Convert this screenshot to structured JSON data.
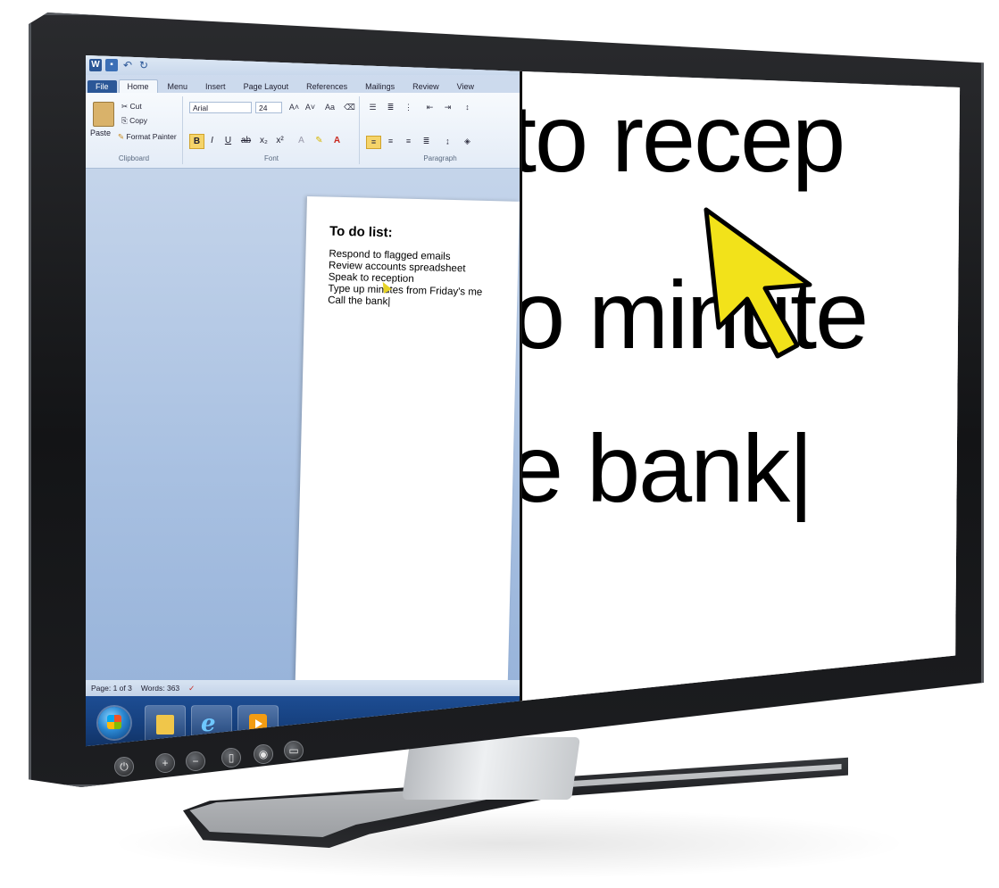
{
  "word": {
    "tabs": [
      "File",
      "Home",
      "Menu",
      "Insert",
      "Page Layout",
      "References",
      "Mailings",
      "Review",
      "View"
    ],
    "clipboard": {
      "paste": "Paste",
      "cut": "Cut",
      "copy": "Copy",
      "format_painter": "Format Painter",
      "label": "Clipboard"
    },
    "font": {
      "name": "Arial",
      "size": "24",
      "label": "Font"
    },
    "paragraph": {
      "label": "Paragraph"
    },
    "document": {
      "title": "To do list:",
      "lines": [
        "Respond to flagged emails",
        "Review accounts spreadsheet",
        "Speak to reception",
        "Type up minutes from Friday's me",
        "Call the bank|"
      ]
    },
    "status": {
      "page": "Page: 1 of 3",
      "words": "Words: 363"
    }
  },
  "magnifier": {
    "lines": [
      "to recep",
      "o minute",
      "e bank|"
    ],
    "cursor_color": "#f2e21a"
  },
  "colors": {
    "accent": "#2b5797",
    "taskbar": "#16407e",
    "highlight_button": "#f5d46a"
  },
  "icons": [
    "word-icon",
    "save-icon",
    "undo-icon",
    "paste-icon",
    "scissors-icon",
    "copy-icon",
    "brush-icon",
    "windows-start-icon",
    "folder-icon",
    "internet-explorer-icon",
    "media-player-icon",
    "power-icon",
    "plus-icon",
    "minus-icon"
  ]
}
